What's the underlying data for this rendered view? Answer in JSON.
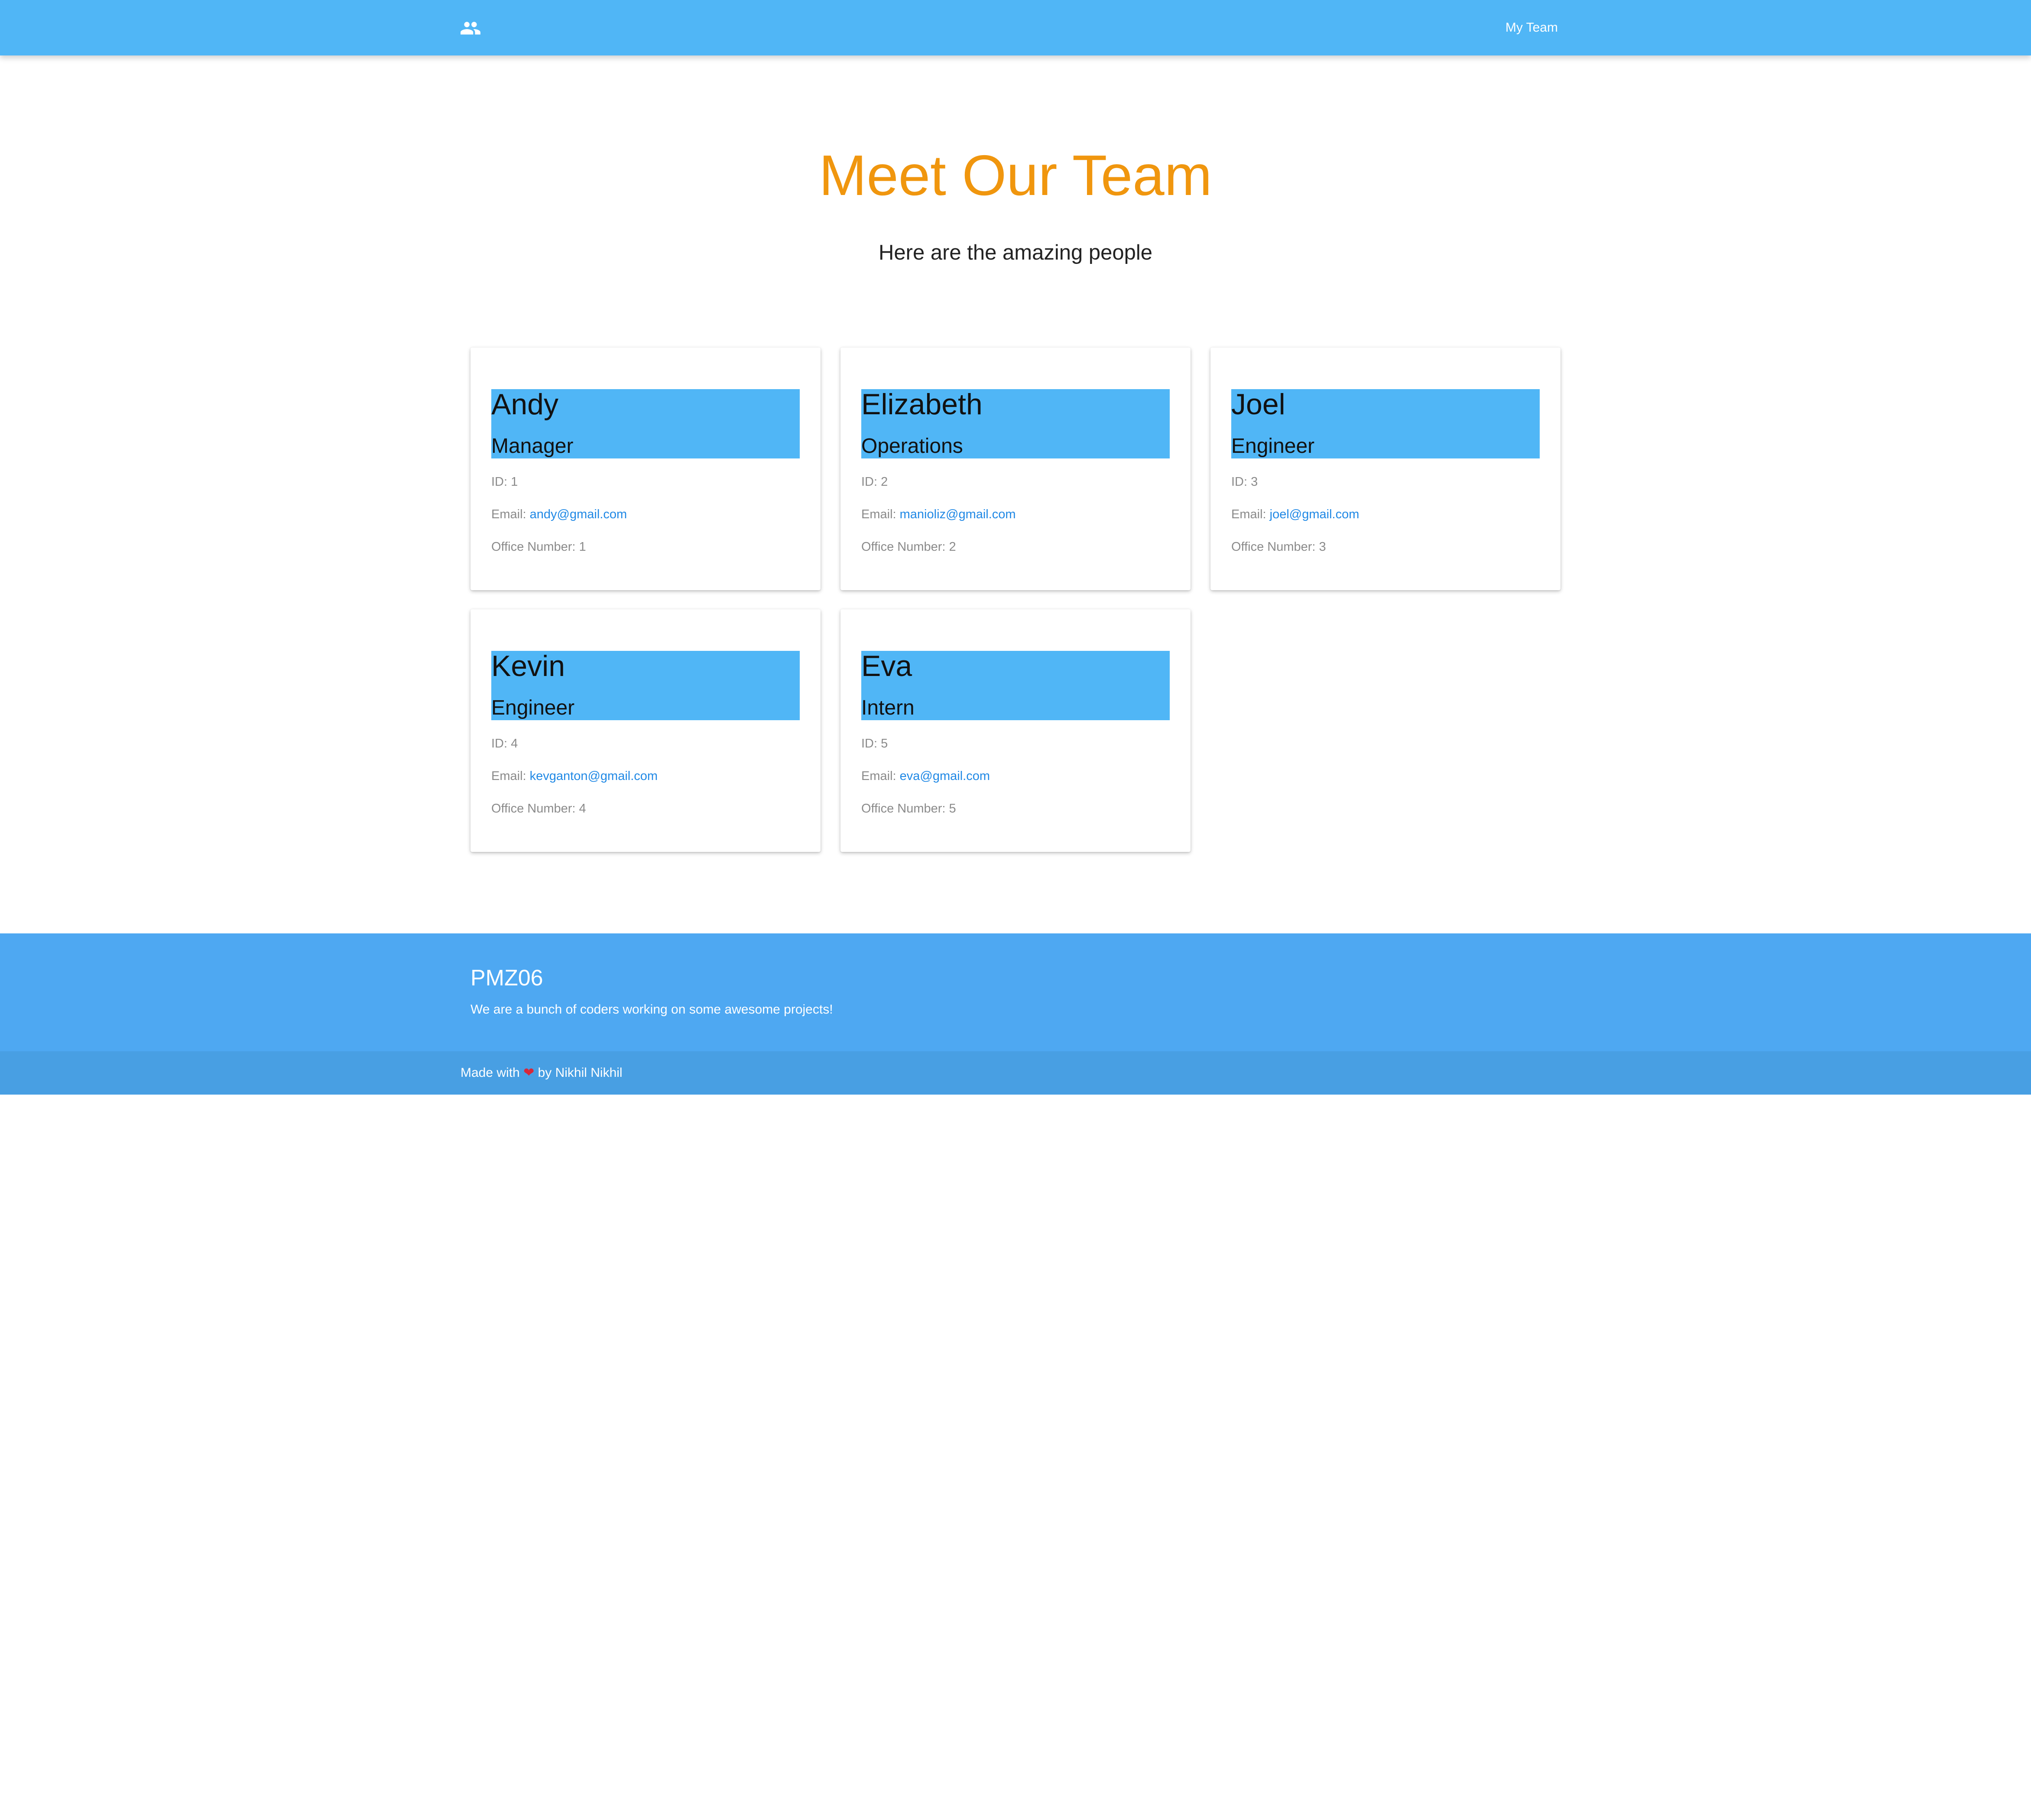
{
  "nav": {
    "logo_icon": "people-icon",
    "link": "My Team"
  },
  "header": {
    "title": "Meet Our Team",
    "subtitle": "Here are the amazing people"
  },
  "members": [
    {
      "name": "Andy",
      "role": "Manager",
      "id_label": "ID: 1",
      "email_label": "Email: ",
      "email": "andy@gmail.com",
      "office_label": "Office Number: 1"
    },
    {
      "name": "Elizabeth",
      "role": "Operations",
      "id_label": "ID: 2",
      "email_label": "Email: ",
      "email": "manioliz@gmail.com",
      "office_label": "Office Number: 2"
    },
    {
      "name": "Joel",
      "role": "Engineer",
      "id_label": "ID: 3",
      "email_label": "Email: ",
      "email": "joel@gmail.com",
      "office_label": "Office Number: 3"
    },
    {
      "name": "Kevin",
      "role": "Engineer",
      "id_label": "ID: 4",
      "email_label": "Email: ",
      "email": "kevganton@gmail.com",
      "office_label": "Office Number: 4"
    },
    {
      "name": "Eva",
      "role": "Intern",
      "id_label": "ID: 5",
      "email_label": "Email: ",
      "email": "eva@gmail.com",
      "office_label": "Office Number: 5"
    }
  ],
  "footer": {
    "title": "PMZ06",
    "text": "We are a bunch of coders working on some awesome projects!",
    "made_with_prefix": "Made with ",
    "heart": "❤",
    "made_with_suffix": " by Nikhil Nikhil"
  },
  "colors": {
    "primary": "#50b6f6",
    "title_orange": "#f0960e",
    "link_blue": "#1f88e5",
    "footer_blue": "#4ea8f2",
    "footer_bottom_blue": "#489fe3",
    "heart_red": "#d8283a"
  }
}
